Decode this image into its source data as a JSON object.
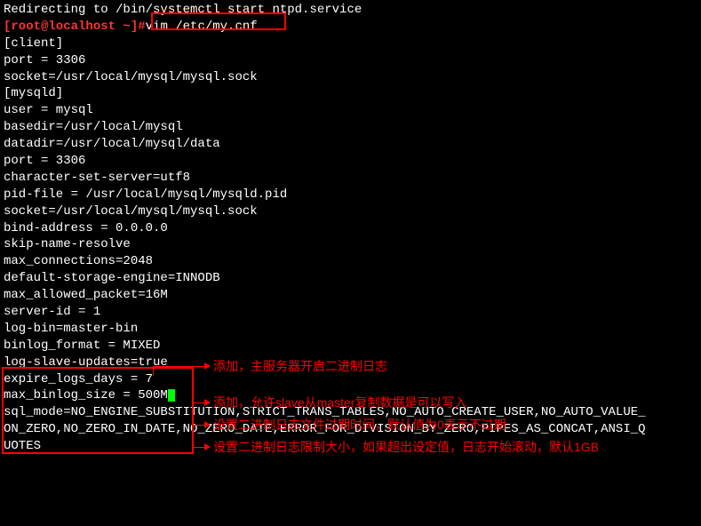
{
  "redirect_line": "Redirecting to /bin/systemctl start ntpd.service",
  "prompt": {
    "user_host": "[root@localhost ~]",
    "hash": "#",
    "command": "vim /etc/my.cnf"
  },
  "config_lines": {
    "blank1": "",
    "client": "[client]",
    "port1": "port = 3306",
    "socket1": "socket=/usr/local/mysql/mysql.sock",
    "blank2": "",
    "mysqld": "[mysqld]",
    "user": "user = mysql",
    "basedir": "basedir=/usr/local/mysql",
    "datadir": "datadir=/usr/local/mysql/data",
    "port2": "port = 3306",
    "charset": "character-set-server=utf8",
    "pidfile": "pid-file = /usr/local/mysql/mysqld.pid",
    "socket2": "socket=/usr/local/mysql/mysql.sock",
    "bindaddr": "bind-address = 0.0.0.0",
    "skipname": "skip-name-resolve",
    "maxconn": "max_connections=2048",
    "engine": "default-storage-engine=INNODB",
    "maxpacket": "max_allowed_packet=16M",
    "serverid": "server-id = 1",
    "blank3": "",
    "logbin": "log-bin=master-bin",
    "binlogfmt": "binlog_format = MIXED",
    "logslave": "log-slave-updates=true",
    "expire": "expire_logs_days = 7",
    "maxbinlog": "max_binlog_size = 500M",
    "blank4": "",
    "sqlmode1": "sql_mode=NO_ENGINE_SUBSTITUTION,STRICT_TRANS_TABLES,NO_AUTO_CREATE_USER,NO_AUTO_VALUE_",
    "sqlmode2": "ON_ZERO,NO_ZERO_IN_DATE,NO_ZERO_DATE,ERROR_FOR_DIVISION_BY_ZERO,PIPES_AS_CONCAT,ANSI_Q",
    "sqlmode3": "UOTES"
  },
  "annotations": {
    "a1": "添加，主服务器开启二进制日志",
    "a2": "添加，允许slave从master复制数据是可以写入",
    "a3": "设置二进制日志文件过期时间，默认值为0表示不过期",
    "a4": "设置二进制日志限制大小，如果超出设定值，日志开始滚动，默认1GB"
  }
}
